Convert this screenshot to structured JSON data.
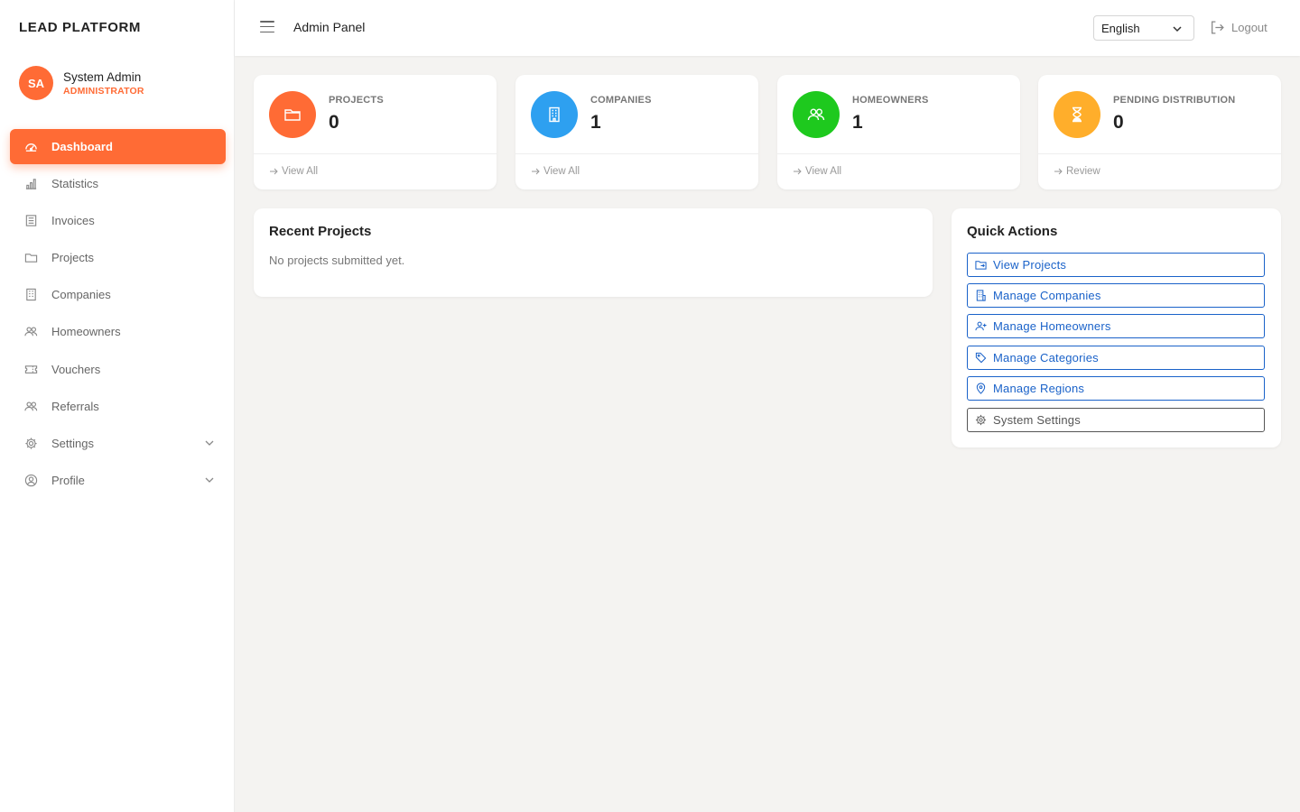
{
  "brand": "LEAD PLATFORM",
  "user": {
    "initials": "SA",
    "name": "System Admin",
    "role": "ADMINISTRATOR"
  },
  "colors": {
    "accent": "#ff6b35",
    "blue": "#2ea0f0",
    "green": "#1ec91e",
    "amber": "#ffae2b",
    "link": "#1a62c9"
  },
  "nav": [
    {
      "label": "Dashboard",
      "icon": "dashboard-icon"
    },
    {
      "label": "Statistics",
      "icon": "bar-chart-icon"
    },
    {
      "label": "Invoices",
      "icon": "invoice-icon"
    },
    {
      "label": "Projects",
      "icon": "folder-icon"
    },
    {
      "label": "Companies",
      "icon": "building-icon"
    },
    {
      "label": "Homeowners",
      "icon": "people-icon"
    },
    {
      "label": "Vouchers",
      "icon": "ticket-icon"
    },
    {
      "label": "Referrals",
      "icon": "people-icon"
    },
    {
      "label": "Settings",
      "icon": "gear-icon"
    },
    {
      "label": "Profile",
      "icon": "user-circle-icon"
    }
  ],
  "header": {
    "title": "Admin Panel",
    "language": "English",
    "logout": "Logout"
  },
  "stats": [
    {
      "label": "PROJECTS",
      "value": "0",
      "link": "View All",
      "icon": "folder-icon"
    },
    {
      "label": "COMPANIES",
      "value": "1",
      "link": "View All",
      "icon": "building-icon"
    },
    {
      "label": "HOMEOWNERS",
      "value": "1",
      "link": "View All",
      "icon": "people-icon"
    },
    {
      "label": "PENDING DISTRIBUTION",
      "value": "0",
      "link": "Review",
      "icon": "hourglass-icon"
    }
  ],
  "recent": {
    "title": "Recent Projects",
    "empty": "No projects submitted yet."
  },
  "quick_actions": {
    "title": "Quick Actions",
    "items": [
      {
        "label": "View Projects",
        "icon": "folder-arrow-icon"
      },
      {
        "label": "Manage Companies",
        "icon": "building-icon"
      },
      {
        "label": "Manage Homeowners",
        "icon": "person-add-icon"
      },
      {
        "label": "Manage Categories",
        "icon": "tag-icon"
      },
      {
        "label": "Manage Regions",
        "icon": "map-pin-icon"
      },
      {
        "label": "System Settings",
        "icon": "gear-icon"
      }
    ]
  }
}
